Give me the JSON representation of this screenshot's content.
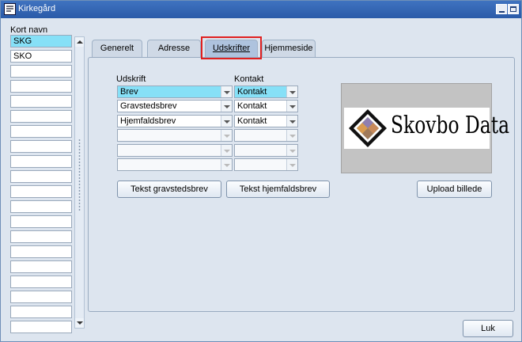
{
  "window": {
    "title": "Kirkegård"
  },
  "list": {
    "header": "Kort navn",
    "items": [
      "SKG",
      "SKO",
      "",
      "",
      "",
      "",
      "",
      "",
      "",
      "",
      "",
      "",
      "",
      "",
      "",
      "",
      "",
      "",
      "",
      ""
    ]
  },
  "tabs": [
    {
      "label": "Generelt"
    },
    {
      "label": "Adresse"
    },
    {
      "label": "Udskrifter"
    },
    {
      "label": "Hjemmeside"
    }
  ],
  "udskrifter": {
    "col_udskrift": "Udskrift",
    "col_kontakt": "Kontakt",
    "rows": [
      {
        "udskrift": "Brev",
        "kontakt": "Kontakt"
      },
      {
        "udskrift": "Gravstedsbrev",
        "kontakt": "Kontakt"
      },
      {
        "udskrift": "Hjemfaldsbrev",
        "kontakt": "Kontakt"
      },
      {
        "udskrift": "",
        "kontakt": ""
      },
      {
        "udskrift": "",
        "kontakt": ""
      },
      {
        "udskrift": "",
        "kontakt": ""
      }
    ],
    "btn_tekst_gravstedsbrev": "Tekst gravstedsbrev",
    "btn_tekst_hjemfaldsbrev": "Tekst hjemfaldsbrev",
    "btn_upload": "Upload billede",
    "logo_text": "Skovbo Data"
  },
  "footer": {
    "luk_label": "Luk"
  },
  "colors": {
    "selected": "#86e0f7",
    "highlight": "#e02020",
    "titlebar": "#2a5aa8"
  }
}
